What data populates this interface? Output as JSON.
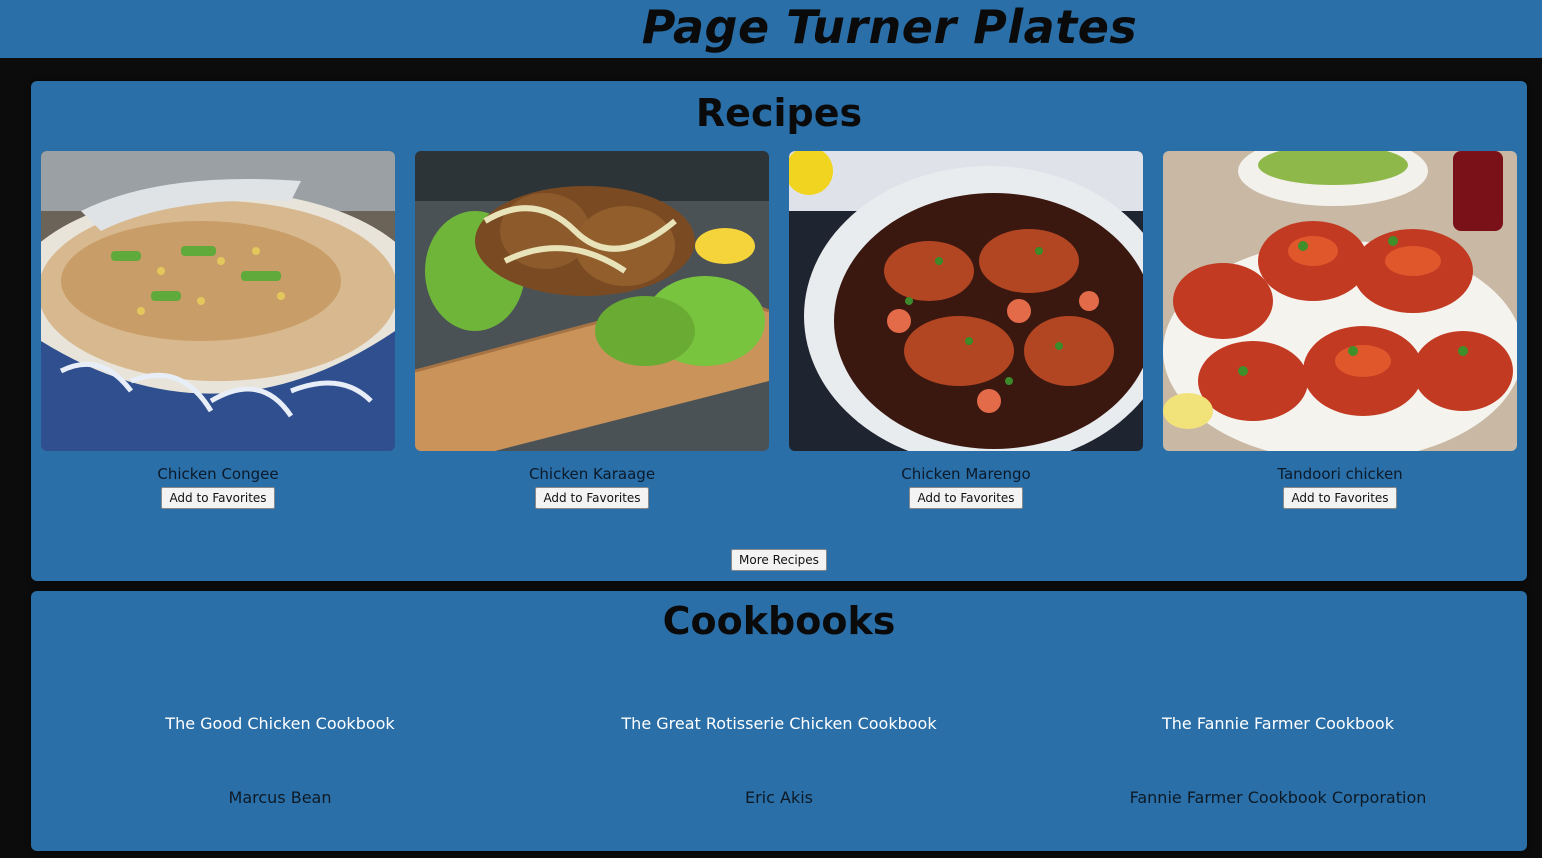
{
  "header": {
    "title": "Page Turner Plates",
    "bg_color": "#2a6fa8"
  },
  "recipes": {
    "heading": "Recipes",
    "items": [
      {
        "name": "Chicken Congee",
        "button": "Add to Favorites",
        "image": "chicken-congee-photo"
      },
      {
        "name": "Chicken Karaage",
        "button": "Add to Favorites",
        "image": "chicken-karaage-photo"
      },
      {
        "name": "Chicken Marengo",
        "button": "Add to Favorites",
        "image": "chicken-marengo-photo"
      },
      {
        "name": "Tandoori chicken",
        "button": "Add to Favorites",
        "image": "tandoori-chicken-photo"
      }
    ],
    "more_button": "More Recipes"
  },
  "cookbooks": {
    "heading": "Cookbooks",
    "items": [
      {
        "title": "The Good Chicken Cookbook",
        "author": "Marcus Bean"
      },
      {
        "title": "The Great Rotisserie Chicken Cookbook",
        "author": "Eric Akis"
      },
      {
        "title": "The Fannie Farmer Cookbook",
        "author": "Fannie Farmer Cookbook Corporation"
      }
    ]
  },
  "colors": {
    "panel": "#2a6fa8",
    "background": "#0c0c0c",
    "accent_text": "#ffffff"
  }
}
